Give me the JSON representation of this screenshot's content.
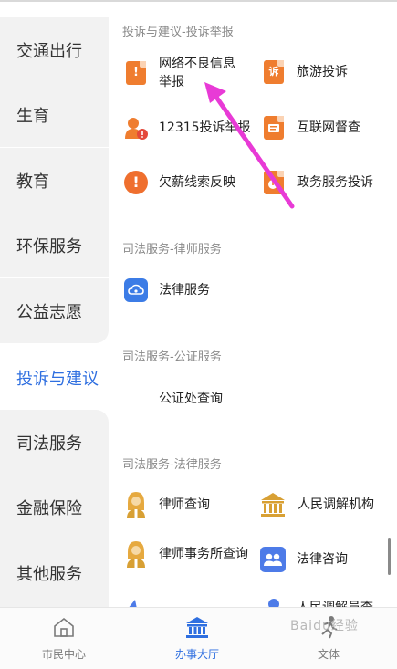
{
  "sidebar": {
    "items": [
      {
        "label": "交通出行"
      },
      {
        "label": "生育"
      },
      {
        "label": "教育"
      },
      {
        "label": "环保服务"
      },
      {
        "label": "公益志愿"
      },
      {
        "label": "投诉与建议"
      },
      {
        "label": "司法服务"
      },
      {
        "label": "金融保险"
      },
      {
        "label": "其他服务"
      }
    ],
    "active_index": 5
  },
  "sections": [
    {
      "title": "投诉与建议-投诉举报",
      "items": [
        {
          "label": "网络不良信息举报",
          "icon": "alert-document-icon"
        },
        {
          "label": "旅游投诉",
          "icon": "complaint-document-icon"
        },
        {
          "label": "12315投诉举报",
          "icon": "person-alert-icon"
        },
        {
          "label": "互联网督查",
          "icon": "internet-supervision-icon"
        },
        {
          "label": "欠薪线索反映",
          "icon": "exclamation-circle-icon"
        },
        {
          "label": "政务服务投诉",
          "icon": "government-complaint-icon"
        }
      ]
    },
    {
      "title": "司法服务-律师服务",
      "items": [
        {
          "label": "法律服务",
          "icon": "cloud-legal-icon"
        }
      ]
    },
    {
      "title": "司法服务-公证服务",
      "items": [
        {
          "label": "公证处查询",
          "icon": ""
        }
      ]
    },
    {
      "title": "司法服务-法律服务",
      "items": [
        {
          "label": "律师查询",
          "icon": "lawyer-icon"
        },
        {
          "label": "人民调解机构",
          "icon": "institution-icon"
        },
        {
          "label": "律师事务所查询",
          "icon": "law-firm-icon"
        },
        {
          "label": "法律咨询",
          "icon": "people-consult-icon"
        },
        {
          "label": "人民调解员查",
          "icon": "mediator-icon"
        }
      ]
    }
  ],
  "bottom_nav": [
    {
      "label": "市民中心",
      "icon": "home-icon"
    },
    {
      "label": "办事大厅",
      "icon": "hall-icon"
    },
    {
      "label": "文体",
      "icon": "sports-icon"
    }
  ],
  "watermark": "Baidu经验",
  "colors": {
    "accent": "#2f6fe0",
    "orange": "#ef7d2f",
    "gold": "#d8a034",
    "pointer": "#e83ad6"
  }
}
